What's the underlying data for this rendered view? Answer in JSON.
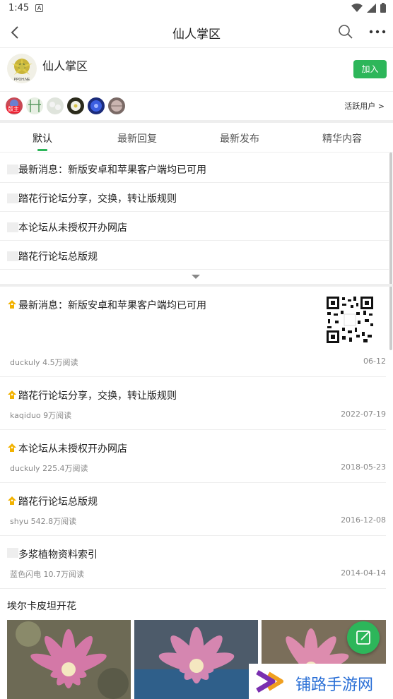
{
  "status": {
    "time": "1:45",
    "notif": "A"
  },
  "appbar": {
    "title": "仙人掌区"
  },
  "forum": {
    "name": "仙人掌区",
    "join_label": "加入",
    "avatar_text": "PPOH.NE",
    "moderator_badge": "版主",
    "active_users_label": "活跃用户 >"
  },
  "tabs": [
    "默认",
    "最新回复",
    "最新发布",
    "精华内容"
  ],
  "pinned": [
    "最新消息：新版安卓和苹果客户端均已可用",
    "踏花行论坛分享，交换，转让版规则",
    "本论坛从未授权开办网店",
    "踏花行论坛总版规"
  ],
  "posts": [
    {
      "title": "最新消息：新版安卓和苹果客户端均已可用",
      "meta": "duckuly 4.5万阅读",
      "date": "06-12",
      "icon": "pin-up-icon"
    },
    {
      "title": "踏花行论坛分享，交换，转让版规则",
      "meta": "kaqiduo 9万阅读",
      "date": "2022-07-19",
      "icon": "pin-up-icon"
    },
    {
      "title": "本论坛从未授权开办网店",
      "meta": "duckuly 225.4万阅读",
      "date": "2018-05-23",
      "icon": "pin-up-icon"
    },
    {
      "title": "踏花行论坛总版规",
      "meta": "shyu 542.8万阅读",
      "date": "2016-12-08",
      "icon": "pin-up-icon"
    },
    {
      "title": "多浆植物资料索引",
      "meta": "蓝色闪电 10.7万阅读",
      "date": "2014-04-14",
      "icon": "none"
    }
  ],
  "gallery": {
    "title": "埃尔卡皮坦开花"
  },
  "watermark": {
    "text": "铺路手游网"
  },
  "colors": {
    "accent": "#2db65a",
    "pin_icon": "#f2b200",
    "flower": "#e07ab0"
  }
}
